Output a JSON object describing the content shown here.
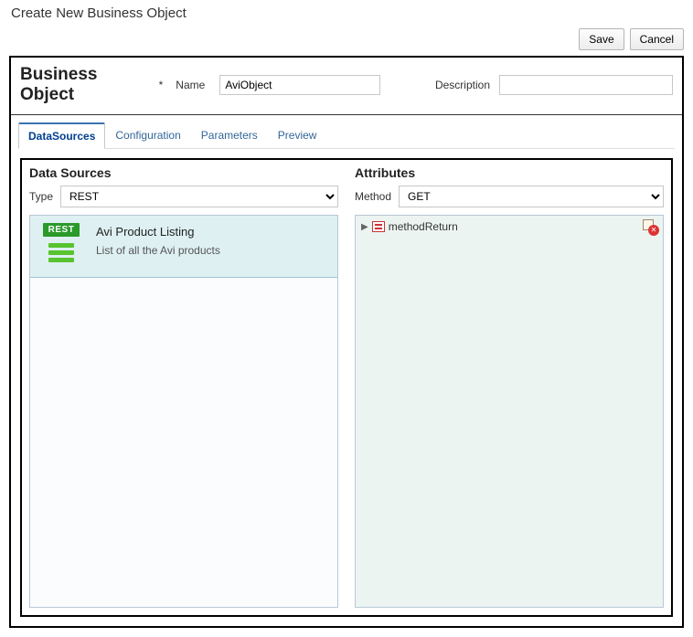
{
  "dialog": {
    "title": "Create New Business Object"
  },
  "actions": {
    "save": "Save",
    "cancel": "Cancel"
  },
  "header": {
    "title": "Business Object",
    "nameLabel": "Name",
    "nameValue": "AviObject",
    "descLabel": "Description",
    "descValue": ""
  },
  "tabs": [
    {
      "label": "DataSources",
      "active": true
    },
    {
      "label": "Configuration",
      "active": false
    },
    {
      "label": "Parameters",
      "active": false
    },
    {
      "label": "Preview",
      "active": false
    }
  ],
  "dataSources": {
    "title": "Data Sources",
    "typeLabel": "Type",
    "typeValue": "REST",
    "items": [
      {
        "badge": "REST",
        "name": "Avi Product Listing",
        "desc": "List of all the Avi products"
      }
    ]
  },
  "attributes": {
    "title": "Attributes",
    "methodLabel": "Method",
    "methodValue": "GET",
    "tree": [
      {
        "label": "methodReturn"
      }
    ]
  }
}
